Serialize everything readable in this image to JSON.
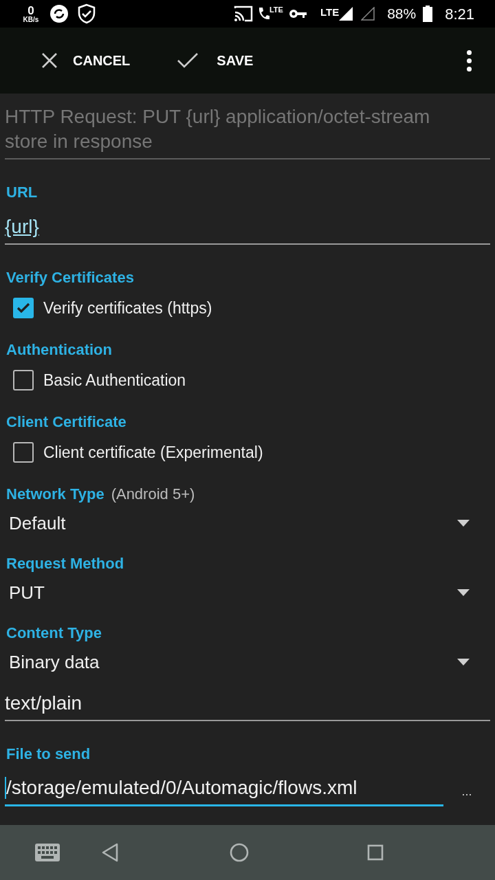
{
  "status_bar": {
    "speed": "0",
    "speed_unit": "KB/s",
    "call_badge": "LTE",
    "network": "LTE",
    "battery": "88%",
    "time": "8:21"
  },
  "toolbar": {
    "cancel": "CANCEL",
    "save": "SAVE"
  },
  "name_field": {
    "placeholder": "HTTP Request: PUT {url} application/octet-stream store in response"
  },
  "sections": [
    {
      "label": "URL",
      "items": [
        {
          "kind": "field",
          "value": "{url}",
          "variable": true,
          "focused": false
        }
      ]
    },
    {
      "label": "Verify Certificates",
      "items": [
        {
          "kind": "checkbox",
          "label": "Verify certificates (https)",
          "checked": true
        }
      ]
    },
    {
      "label": "Authentication",
      "items": [
        {
          "kind": "checkbox",
          "label": "Basic Authentication",
          "checked": false
        }
      ]
    },
    {
      "label": "Client Certificate",
      "items": [
        {
          "kind": "checkbox",
          "label": "Client certificate (Experimental)",
          "checked": false
        }
      ]
    },
    {
      "label": "Network Type",
      "note": "(Android 5+)",
      "items": [
        {
          "kind": "dropdown",
          "value": "Default"
        }
      ]
    },
    {
      "label": "Request Method",
      "items": [
        {
          "kind": "dropdown",
          "value": "PUT"
        }
      ]
    },
    {
      "label": "Content Type",
      "items": [
        {
          "kind": "dropdown",
          "value": "Binary data"
        },
        {
          "kind": "field",
          "value": "text/plain",
          "variable": false,
          "focused": false
        }
      ]
    },
    {
      "label": "File to send",
      "items": [
        {
          "kind": "field",
          "value": "/storage/emulated/0/Automagic/flows.xml",
          "variable": false,
          "focused": true,
          "browse": "..."
        }
      ]
    }
  ]
}
